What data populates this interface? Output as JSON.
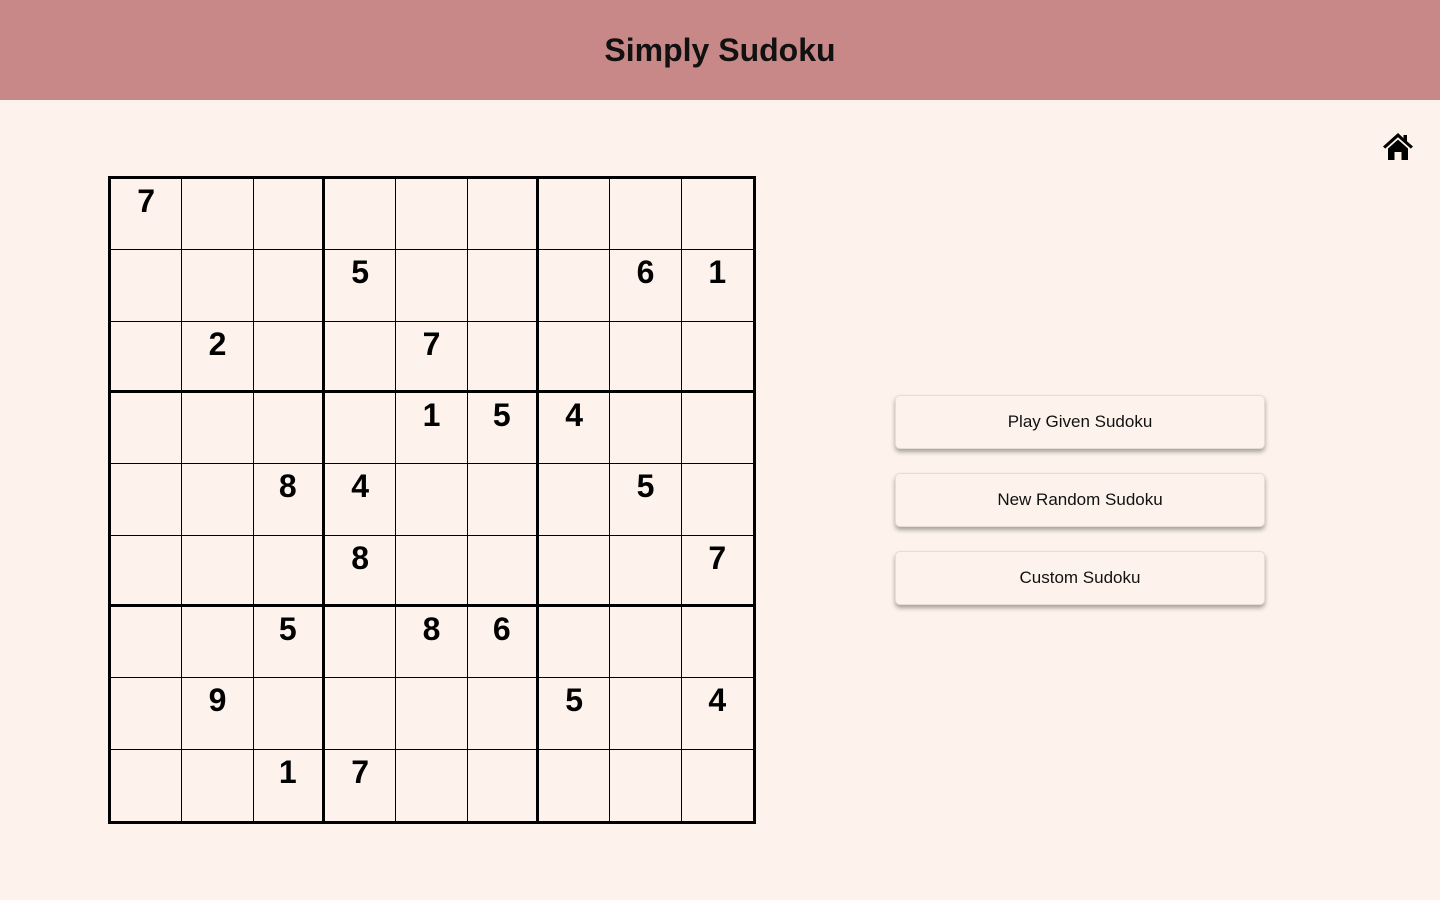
{
  "header": {
    "title": "Simply Sudoku"
  },
  "nav": {
    "home_icon": "home-icon"
  },
  "board": {
    "rows": [
      [
        "7",
        "",
        "",
        "",
        "",
        "",
        "",
        "",
        ""
      ],
      [
        "",
        "",
        "",
        "5",
        "",
        "",
        "",
        "6",
        "1"
      ],
      [
        "",
        "2",
        "",
        "",
        "7",
        "",
        "",
        "",
        ""
      ],
      [
        "",
        "",
        "",
        "",
        "1",
        "5",
        "4",
        "",
        ""
      ],
      [
        "",
        "",
        "8",
        "4",
        "",
        "",
        "",
        "5",
        ""
      ],
      [
        "",
        "",
        "",
        "8",
        "",
        "",
        "",
        "",
        "7"
      ],
      [
        "",
        "",
        "5",
        "",
        "8",
        "6",
        "",
        "",
        ""
      ],
      [
        "",
        "9",
        "",
        "",
        "",
        "",
        "5",
        "",
        "4"
      ],
      [
        "",
        "",
        "1",
        "7",
        "",
        "",
        "",
        "",
        ""
      ]
    ]
  },
  "actions": {
    "play_given": "Play Given Sudoku",
    "new_random": "New Random Sudoku",
    "custom": "Custom Sudoku"
  },
  "colors": {
    "header_bg": "#c98888",
    "page_bg": "#fdf3ec"
  }
}
